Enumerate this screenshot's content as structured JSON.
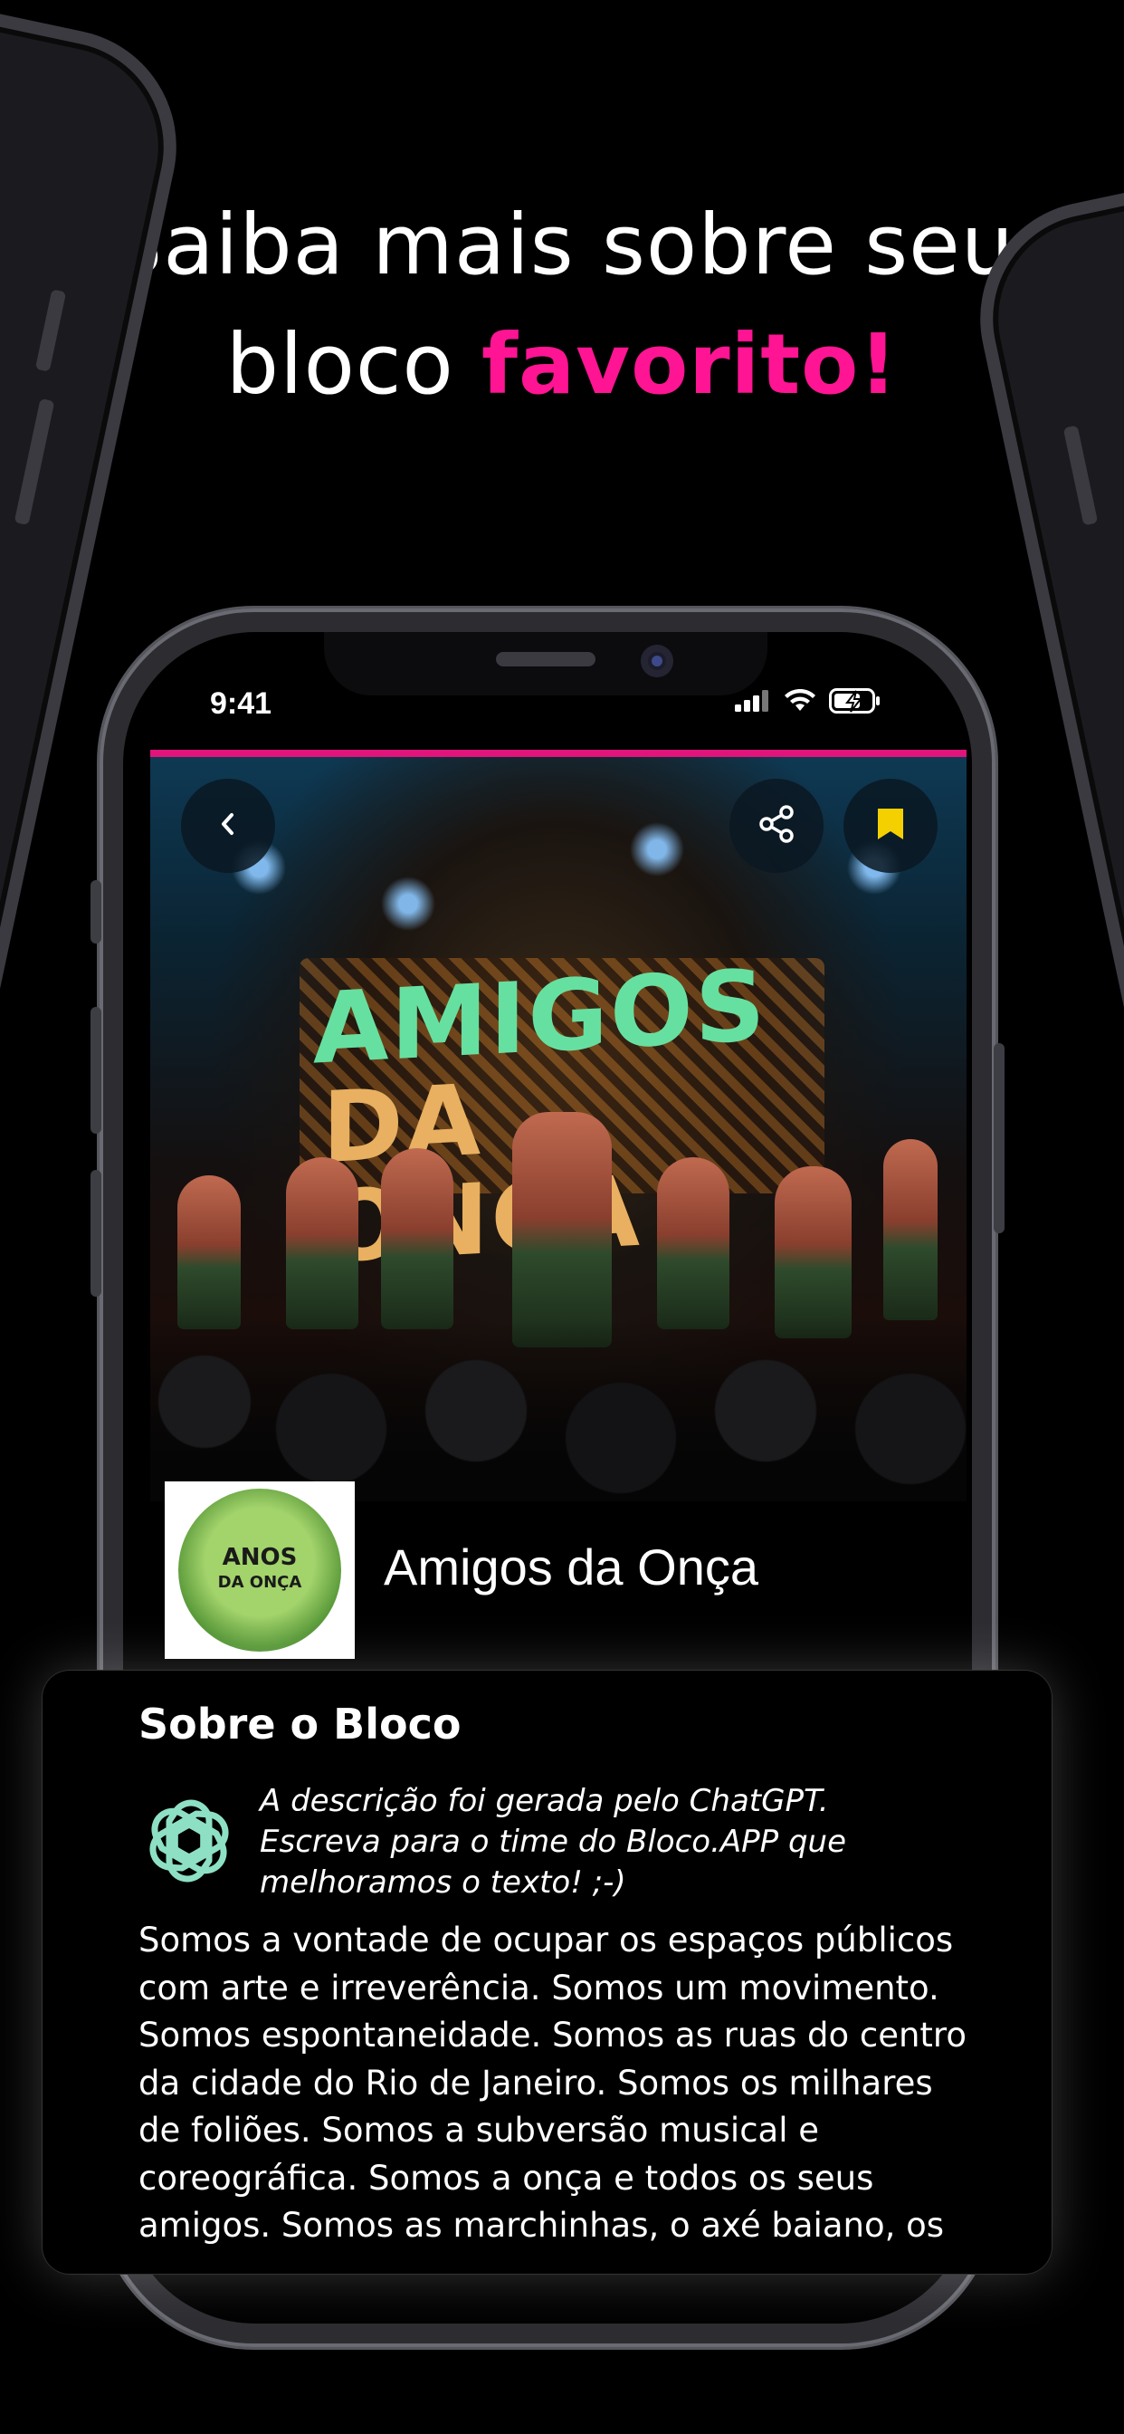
{
  "headline": {
    "line1": "Saiba mais sobre seu",
    "line2_prefix": "bloco ",
    "line2_accent": "favorito!"
  },
  "colors": {
    "accent": "#ff1493",
    "background": "#000000",
    "bookmark": "#f5d000",
    "gpt_logo": "#8ee0c4"
  },
  "status_bar": {
    "time": "9:41",
    "icons": [
      "signal-icon",
      "wifi-icon",
      "battery-charging-icon"
    ]
  },
  "hero": {
    "sign_line1": "AMIGOS",
    "sign_line2": "DA ONÇA",
    "back_icon": "chevron-left-icon",
    "share_icon": "share-icon",
    "bookmark_icon": "bookmark-icon"
  },
  "bloco": {
    "logo_text_1": "ANOS",
    "logo_text_2": "DA ONÇA",
    "name": "Amigos da Onça"
  },
  "about": {
    "title": "Sobre o Bloco",
    "gpt_icon": "openai-logo-icon",
    "gpt_note": "A descrição foi gerada pelo ChatGPT. Escreva para o time do Bloco.APP que melhoramos o texto! ;-)",
    "body": "Somos a vontade de ocupar os espaços públicos com arte e irreverência. Somos um movimento. Somos espontaneidade. Somos as ruas do centro da cidade do Rio de Janeiro. Somos os milhares de foliões.  Somos a subversão musical e coreográfica. Somos a onça e todos os seus amigos. Somos as marchinhas, o axé baiano, os"
  }
}
